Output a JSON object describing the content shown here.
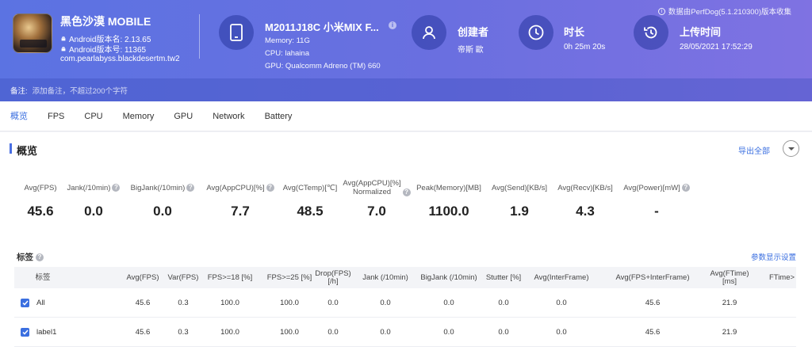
{
  "header": {
    "app": {
      "name": "黑色沙漠 MOBILE",
      "version_name": "Android版本名: 2.13.65",
      "version_code": "Android版本号: 11365",
      "package": "com.pearlabyss.blackdesertm.tw2"
    },
    "device": {
      "title": "M2011J18C 小米MIX F...",
      "memory": "Memory: 11G",
      "cpu": "CPU: lahaina",
      "gpu": "GPU: Qualcomm Adreno (TM) 660"
    },
    "creator": {
      "title": "创建者",
      "value": "帝斯 歐"
    },
    "duration": {
      "title": "时长",
      "value": "0h 25m 20s"
    },
    "upload": {
      "title": "上传时间",
      "value": "28/05/2021 17:52:29"
    },
    "collect_note": "数据由PerfDog(5.1.210300)版本收集",
    "notes_label": "备注:",
    "notes_placeholder": "添加备注，不超过200个字符"
  },
  "tabs": [
    "概览",
    "FPS",
    "CPU",
    "Memory",
    "GPU",
    "Network",
    "Battery"
  ],
  "overview": {
    "title": "概览",
    "export_label": "导出全部",
    "metrics": [
      {
        "label": "Avg(FPS)",
        "value": "45.6",
        "help": false
      },
      {
        "label": "Jank(/10min)",
        "value": "0.0",
        "help": true
      },
      {
        "label": "BigJank(/10min)",
        "value": "0.0",
        "help": true
      },
      {
        "label": "Avg(AppCPU)[%]",
        "value": "7.7",
        "help": true
      },
      {
        "label": "Avg(CTemp)[℃]",
        "value": "48.5",
        "help": false
      },
      {
        "label": "Avg(AppCPU)[%]",
        "label2": "Normalized",
        "value": "7.0",
        "help": true
      },
      {
        "label": "Peak(Memory)[MB]",
        "value": "1100.0",
        "help": false
      },
      {
        "label": "Avg(Send)[KB/s]",
        "value": "1.9",
        "help": false
      },
      {
        "label": "Avg(Recv)[KB/s]",
        "value": "4.3",
        "help": false
      },
      {
        "label": "Avg(Power)[mW]",
        "value": "-",
        "help": true
      }
    ]
  },
  "tags": {
    "title": "标签",
    "param_settings_label": "参数显示设置",
    "columns": [
      "标签",
      "Avg(FPS)",
      "Var(FPS)",
      "FPS>=18 [%]",
      "FPS>=25 [%]",
      "Drop(FPS) [/h]",
      "Jank (/10min)",
      "BigJank (/10min)",
      "Stutter [%]",
      "Avg(InterFrame)",
      "Avg(FPS+InterFrame)",
      "Avg(FTime) [ms]",
      "FTime>"
    ],
    "rows": [
      {
        "label": "All",
        "checked": true,
        "cells": [
          "45.6",
          "0.3",
          "100.0",
          "100.0",
          "0.0",
          "0.0",
          "0.0",
          "0.0",
          "0.0",
          "45.6",
          "21.9"
        ]
      },
      {
        "label": "label1",
        "checked": true,
        "cells": [
          "45.6",
          "0.3",
          "100.0",
          "100.0",
          "0.0",
          "0.0",
          "0.0",
          "0.0",
          "0.0",
          "45.6",
          "21.9"
        ]
      }
    ]
  }
}
